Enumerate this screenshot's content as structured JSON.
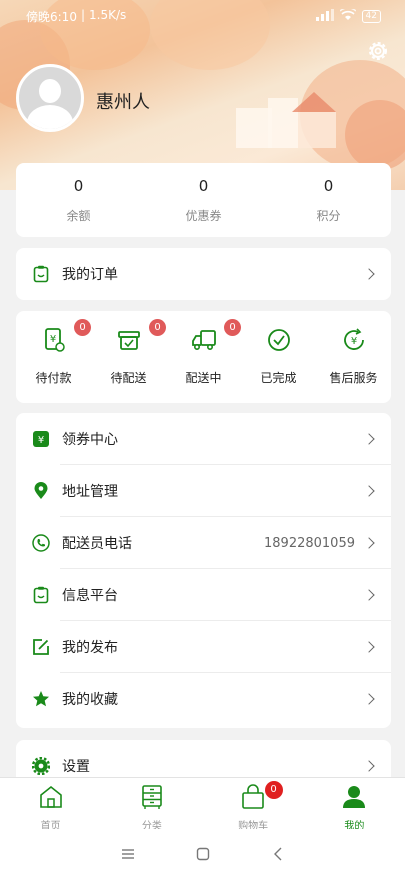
{
  "statusbar": {
    "time": "傍晚6:10",
    "speed": "1.5K/s",
    "battery": "42"
  },
  "profile": {
    "username": "惠州人"
  },
  "stats": [
    {
      "value": "0",
      "label": "余额"
    },
    {
      "value": "0",
      "label": "优惠券"
    },
    {
      "value": "0",
      "label": "积分"
    }
  ],
  "orders": {
    "label": "我的订单"
  },
  "order_status": [
    {
      "label": "待付款",
      "badge": "0"
    },
    {
      "label": "待配送",
      "badge": "0"
    },
    {
      "label": "配送中",
      "badge": "0"
    },
    {
      "label": "已完成"
    },
    {
      "label": "售后服务"
    }
  ],
  "menu": [
    {
      "label": "领券中心",
      "icon": "coupon-icon"
    },
    {
      "label": "地址管理",
      "icon": "location-icon"
    },
    {
      "label": "配送员电话",
      "value": "18922801059",
      "icon": "phone-icon"
    },
    {
      "label": "信息平台",
      "icon": "clipboard-icon"
    },
    {
      "label": "我的发布",
      "icon": "edit-icon"
    },
    {
      "label": "我的收藏",
      "icon": "star-icon"
    }
  ],
  "settings": {
    "label": "设置"
  },
  "tabbar": [
    {
      "label": "首页",
      "icon": "home-icon"
    },
    {
      "label": "分类",
      "icon": "category-icon"
    },
    {
      "label": "购物车",
      "icon": "cart-icon",
      "badge": "0"
    },
    {
      "label": "我的",
      "icon": "user-icon"
    }
  ],
  "colors": {
    "accent": "#1a8a1a",
    "badge": "#e05a5a"
  }
}
